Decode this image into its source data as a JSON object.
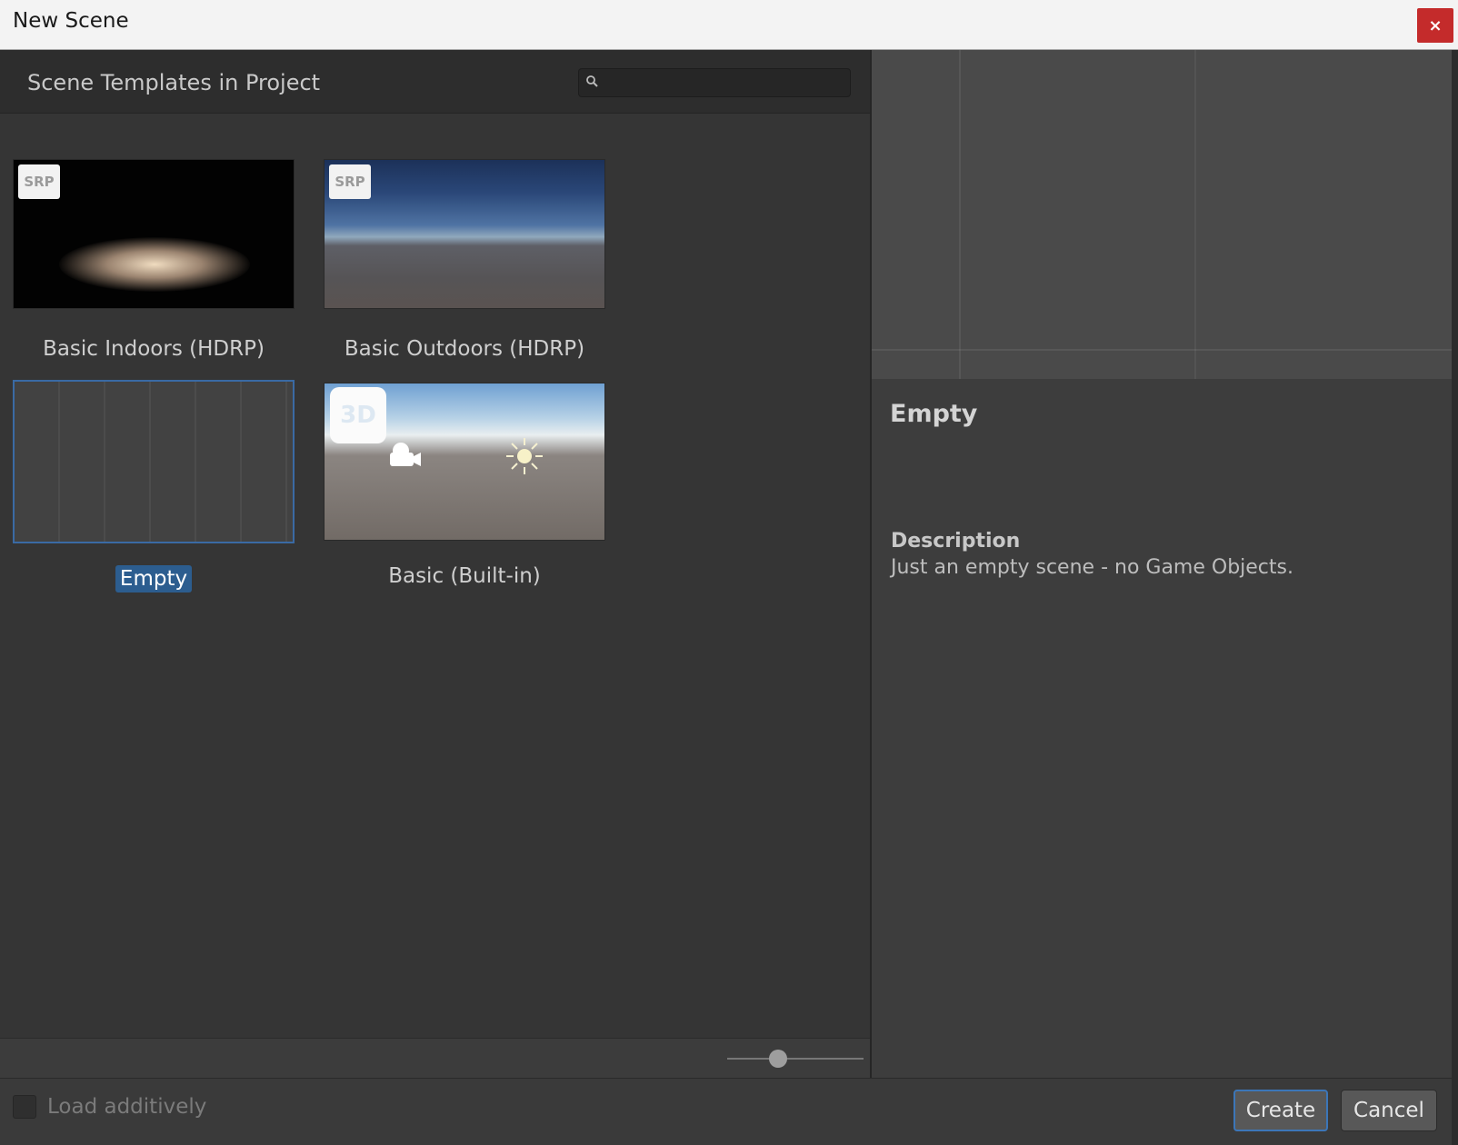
{
  "window": {
    "title": "New Scene",
    "close_label": "×"
  },
  "left_panel": {
    "section_title": "Scene Templates in Project",
    "search": {
      "value": "",
      "icon": "search-icon"
    },
    "templates": [
      {
        "label": "Basic Indoors (HDRP)",
        "badge": "SRP",
        "selected": false
      },
      {
        "label": "Basic Outdoors (HDRP)",
        "badge": "SRP",
        "selected": false
      },
      {
        "label": "Empty",
        "badge": "",
        "selected": true
      },
      {
        "label": "Basic (Built-in)",
        "badge": "3D",
        "selected": false
      }
    ],
    "zoom_slider": {
      "level": 0.37
    }
  },
  "details": {
    "title": "Empty",
    "description_heading": "Description",
    "description_text": "Just an empty scene - no Game Objects."
  },
  "footer": {
    "load_additively_label": "Load additively",
    "load_additively_checked": false,
    "create_label": "Create",
    "cancel_label": "Cancel"
  },
  "colors": {
    "accent": "#2c5d8f",
    "close_button": "#c42b2b",
    "selection_border": "#3a6aa4"
  }
}
